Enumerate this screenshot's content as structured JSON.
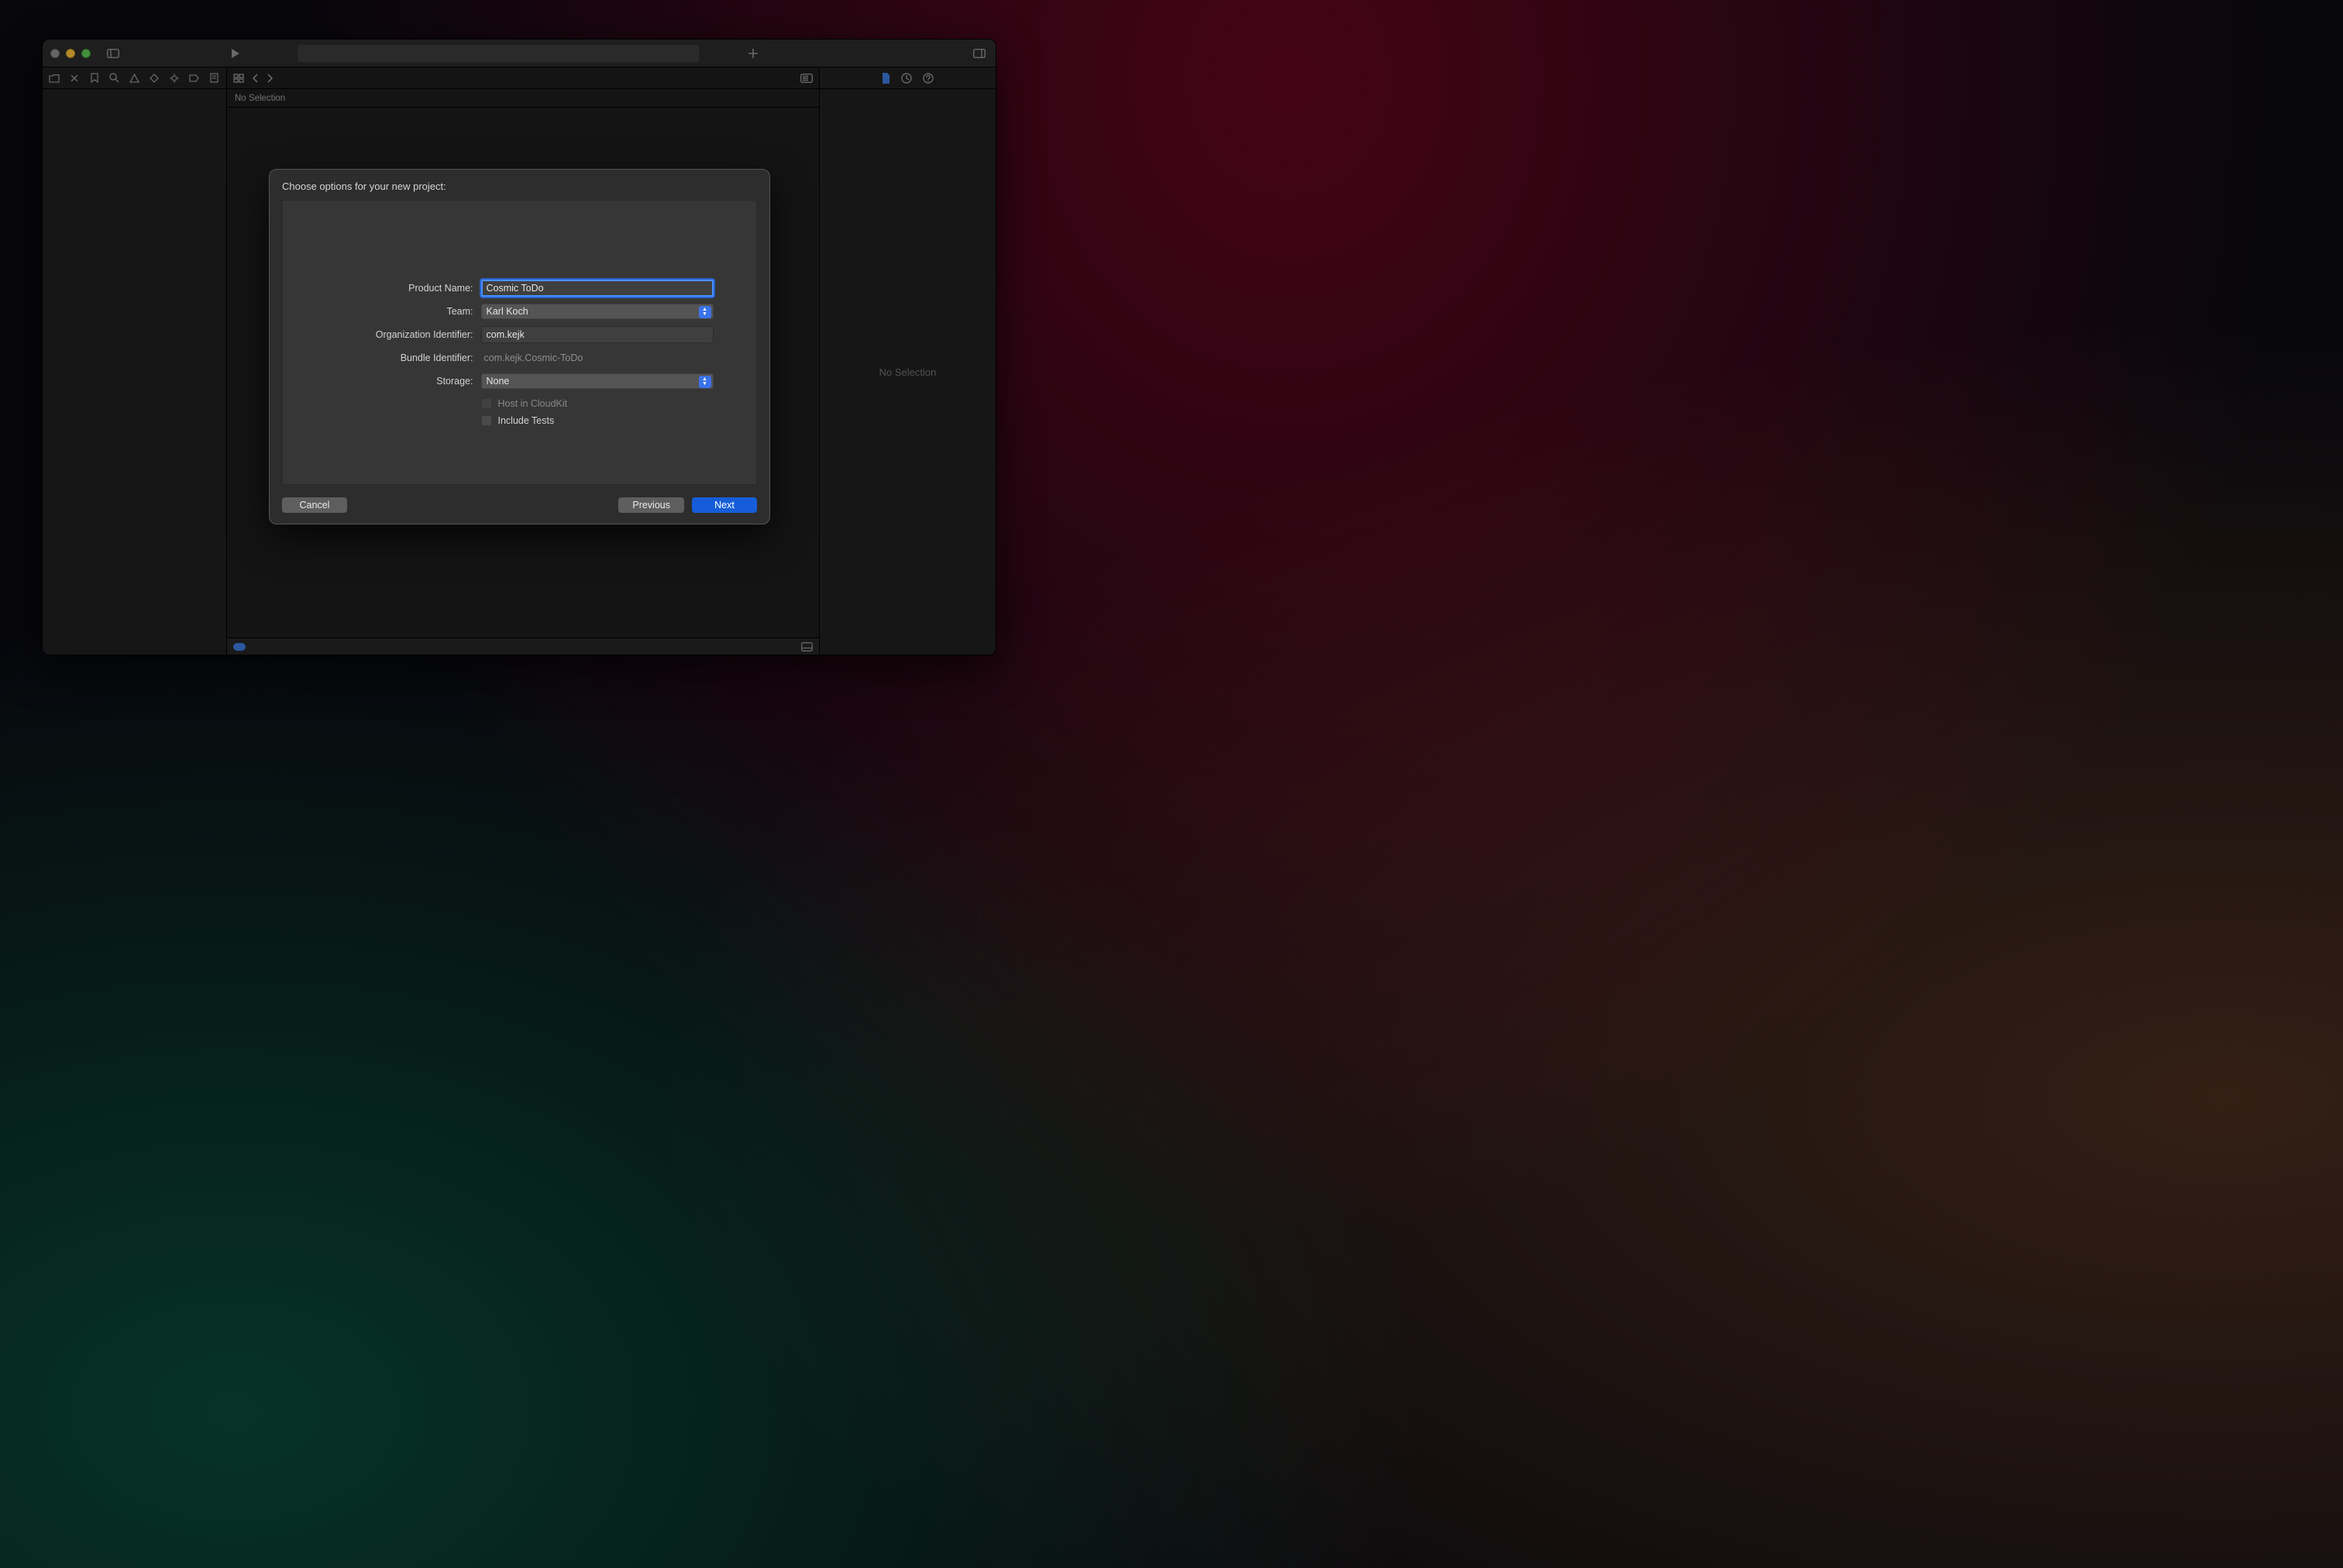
{
  "editor": {
    "jumpbar_text": "No Selection"
  },
  "inspector": {
    "empty_text": "No Selection"
  },
  "sheet": {
    "title": "Choose options for your new project:",
    "labels": {
      "product_name": "Product Name:",
      "team": "Team:",
      "org_id": "Organization Identifier:",
      "bundle_id": "Bundle Identifier:",
      "storage": "Storage:"
    },
    "values": {
      "product_name": "Cosmic ToDo",
      "team": "Karl Koch",
      "org_id": "com.kejk",
      "bundle_id": "com.kejk.Cosmic-ToDo",
      "storage": "None"
    },
    "checkboxes": {
      "cloudkit_label": "Host in CloudKit",
      "cloudkit_enabled": false,
      "include_tests_label": "Include Tests",
      "include_tests_checked": false
    },
    "buttons": {
      "cancel": "Cancel",
      "previous": "Previous",
      "next": "Next"
    }
  }
}
